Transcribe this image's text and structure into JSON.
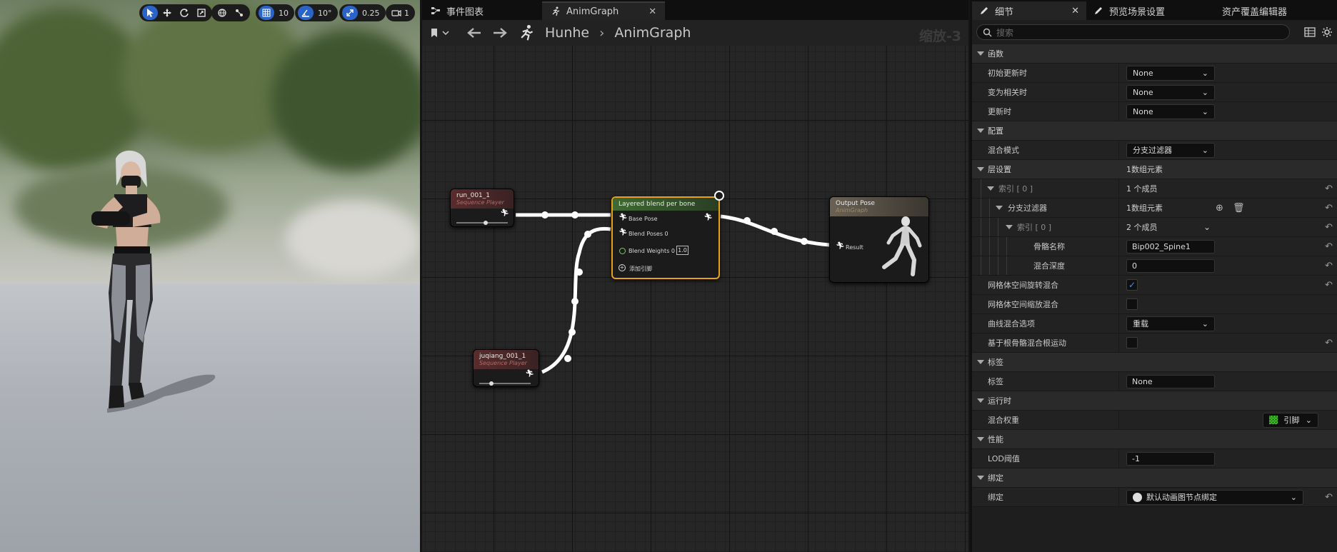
{
  "viewport": {
    "toolbar": {
      "grid_snap_value": "10",
      "rotation_snap_value": "10°",
      "scale_snap_value": "0.25",
      "camera_speed": "1"
    }
  },
  "graph": {
    "tabs": [
      {
        "label": "事件图表"
      },
      {
        "label": "AnimGraph"
      }
    ],
    "breadcrumb": {
      "root": "Hunhe",
      "current": "AnimGraph"
    },
    "zoom": "缩放-3",
    "nodes": {
      "run": {
        "title": "run_001_1",
        "subtitle": "Sequence Player"
      },
      "juqiang": {
        "title": "juqiang_001_1",
        "subtitle": "Sequence Player"
      },
      "layered": {
        "title": "Layered blend per bone",
        "base_pose": "Base Pose",
        "blend_poses": "Blend Poses 0",
        "blend_weights": "Blend Weights 0",
        "blend_weights_value": "1.0",
        "add_pin": "添加引脚"
      },
      "output": {
        "title": "Output Pose",
        "subtitle": "AnimGraph",
        "result": "Result"
      }
    }
  },
  "details": {
    "tabs": [
      {
        "label": "细节"
      },
      {
        "label": "预览场景设置"
      },
      {
        "label": "资产覆盖编辑器"
      }
    ],
    "search_placeholder": "搜索",
    "categories": {
      "functions": "函数",
      "config": "配置",
      "layer_setup": "层设置",
      "tags": "标签",
      "runtime": "运行时",
      "performance": "性能",
      "binding": "绑定"
    },
    "props": {
      "on_initial_update": {
        "label": "初始更新时",
        "value": "None"
      },
      "on_become_relevant": {
        "label": "变为相关时",
        "value": "None"
      },
      "on_update": {
        "label": "更新时",
        "value": "None"
      },
      "blend_mode": {
        "label": "混合模式",
        "value": "分支过滤器"
      },
      "layer_setup": {
        "value": "1数组元素"
      },
      "index0": {
        "label": "索引 [ 0 ]",
        "value": "1 个成员"
      },
      "branch_filters": {
        "label": "分支过滤器",
        "value": "1数组元素"
      },
      "index0_inner": {
        "label": "索引 [ 0 ]",
        "value": "2 个成员"
      },
      "bone_name": {
        "label": "骨骼名称",
        "value": "Bip002_Spine1"
      },
      "blend_depth": {
        "label": "混合深度",
        "value": "0"
      },
      "mesh_rotation_blend": {
        "label": "网格体空间旋转混合",
        "checked": true
      },
      "mesh_scale_blend": {
        "label": "网格体空间缩放混合",
        "checked": false
      },
      "curve_blend_option": {
        "label": "曲线混合选项",
        "value": "重载"
      },
      "root_motion_blend": {
        "label": "基于根骨骼混合根运动",
        "checked": false
      },
      "tag": {
        "label": "标签",
        "value": "None"
      },
      "blend_weights": {
        "label": "混合权重",
        "value": "引脚"
      },
      "lod_threshold": {
        "label": "LOD阈值",
        "value": "-1"
      },
      "binding": {
        "label": "绑定",
        "value": "默认动画图节点绑定"
      }
    }
  }
}
